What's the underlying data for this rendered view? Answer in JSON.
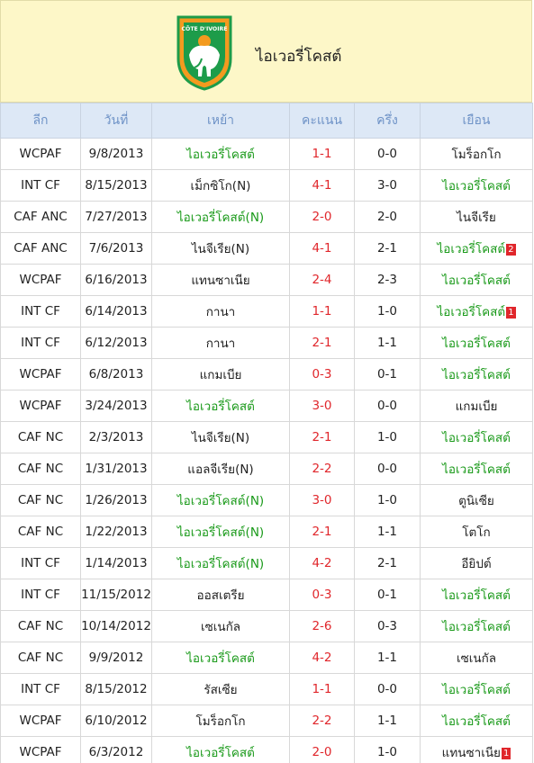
{
  "team_name": "ไอเวอรี่โคสต์",
  "logo_text": "CÔTE D'IVOIRE",
  "colors": {
    "header_bg": "#fdf7c8",
    "green": "#1a9a1a",
    "red": "#e0262b",
    "th_bg": "#dde8f6",
    "th_text": "#6f93c7"
  },
  "columns": [
    "ลีก",
    "วันที่",
    "เหย้า",
    "คะแนน",
    "ครึ่ง",
    "เยือน"
  ],
  "matches": [
    {
      "league": "WCPAF",
      "date": "9/8/2013",
      "home": "ไอเวอรี่โคสต์",
      "score": "1-1",
      "half": "0-0",
      "away": "โมร็อกโก",
      "home_green": true,
      "away_green": false,
      "away_badge": ""
    },
    {
      "league": "INT CF",
      "date": "8/15/2013",
      "home": "เม็กซิโก(N)",
      "score": "4-1",
      "half": "3-0",
      "away": "ไอเวอรี่โคสต์",
      "home_green": false,
      "away_green": true,
      "away_badge": ""
    },
    {
      "league": "CAF ANC",
      "date": "7/27/2013",
      "home": "ไอเวอรี่โคสต์(N)",
      "score": "2-0",
      "half": "2-0",
      "away": "ไนจีเรีย",
      "home_green": true,
      "away_green": false,
      "away_badge": ""
    },
    {
      "league": "CAF ANC",
      "date": "7/6/2013",
      "home": "ไนจีเรีย(N)",
      "score": "4-1",
      "half": "2-1",
      "away": "ไอเวอรี่โคสต์",
      "home_green": false,
      "away_green": true,
      "away_badge": "2"
    },
    {
      "league": "WCPAF",
      "date": "6/16/2013",
      "home": "แทนซาเนีย",
      "score": "2-4",
      "half": "2-3",
      "away": "ไอเวอรี่โคสต์",
      "home_green": false,
      "away_green": true,
      "away_badge": ""
    },
    {
      "league": "INT CF",
      "date": "6/14/2013",
      "home": "กานา",
      "score": "1-1",
      "half": "1-0",
      "away": "ไอเวอรี่โคสต์",
      "home_green": false,
      "away_green": true,
      "away_badge": "1"
    },
    {
      "league": "INT CF",
      "date": "6/12/2013",
      "home": "กานา",
      "score": "2-1",
      "half": "1-1",
      "away": "ไอเวอรี่โคสต์",
      "home_green": false,
      "away_green": true,
      "away_badge": ""
    },
    {
      "league": "WCPAF",
      "date": "6/8/2013",
      "home": "แกมเบีย",
      "score": "0-3",
      "half": "0-1",
      "away": "ไอเวอรี่โคสต์",
      "home_green": false,
      "away_green": true,
      "away_badge": ""
    },
    {
      "league": "WCPAF",
      "date": "3/24/2013",
      "home": "ไอเวอรี่โคสต์",
      "score": "3-0",
      "half": "0-0",
      "away": "แกมเบีย",
      "home_green": true,
      "away_green": false,
      "away_badge": ""
    },
    {
      "league": "CAF NC",
      "date": "2/3/2013",
      "home": "ไนจีเรีย(N)",
      "score": "2-1",
      "half": "1-0",
      "away": "ไอเวอรี่โคสต์",
      "home_green": false,
      "away_green": true,
      "away_badge": ""
    },
    {
      "league": "CAF NC",
      "date": "1/31/2013",
      "home": "แอลจีเรีย(N)",
      "score": "2-2",
      "half": "0-0",
      "away": "ไอเวอรี่โคสต์",
      "home_green": false,
      "away_green": true,
      "away_badge": ""
    },
    {
      "league": "CAF NC",
      "date": "1/26/2013",
      "home": "ไอเวอรี่โคสต์(N)",
      "score": "3-0",
      "half": "1-0",
      "away": "ตูนิเซีย",
      "home_green": true,
      "away_green": false,
      "away_badge": ""
    },
    {
      "league": "CAF NC",
      "date": "1/22/2013",
      "home": "ไอเวอรี่โคสต์(N)",
      "score": "2-1",
      "half": "1-1",
      "away": "โตโก",
      "home_green": true,
      "away_green": false,
      "away_badge": ""
    },
    {
      "league": "INT CF",
      "date": "1/14/2013",
      "home": "ไอเวอรี่โคสต์(N)",
      "score": "4-2",
      "half": "2-1",
      "away": "อียิปต์",
      "home_green": true,
      "away_green": false,
      "away_badge": ""
    },
    {
      "league": "INT CF",
      "date": "11/15/2012",
      "home": "ออสเตรีย",
      "score": "0-3",
      "half": "0-1",
      "away": "ไอเวอรี่โคสต์",
      "home_green": false,
      "away_green": true,
      "away_badge": ""
    },
    {
      "league": "CAF NC",
      "date": "10/14/2012",
      "home": "เซเนกัล",
      "score": "2-6",
      "half": "0-3",
      "away": "ไอเวอรี่โคสต์",
      "home_green": false,
      "away_green": true,
      "away_badge": ""
    },
    {
      "league": "CAF NC",
      "date": "9/9/2012",
      "home": "ไอเวอรี่โคสต์",
      "score": "4-2",
      "half": "1-1",
      "away": "เซเนกัล",
      "home_green": true,
      "away_green": false,
      "away_badge": ""
    },
    {
      "league": "INT CF",
      "date": "8/15/2012",
      "home": "รัสเซีย",
      "score": "1-1",
      "half": "0-0",
      "away": "ไอเวอรี่โคสต์",
      "home_green": false,
      "away_green": true,
      "away_badge": ""
    },
    {
      "league": "WCPAF",
      "date": "6/10/2012",
      "home": "โมร็อกโก",
      "score": "2-2",
      "half": "1-1",
      "away": "ไอเวอรี่โคสต์",
      "home_green": false,
      "away_green": true,
      "away_badge": ""
    },
    {
      "league": "WCPAF",
      "date": "6/3/2012",
      "home": "ไอเวอรี่โคสต์",
      "score": "2-0",
      "half": "1-0",
      "away": "แทนซาเนีย",
      "home_green": true,
      "away_green": false,
      "away_badge": "1"
    }
  ]
}
